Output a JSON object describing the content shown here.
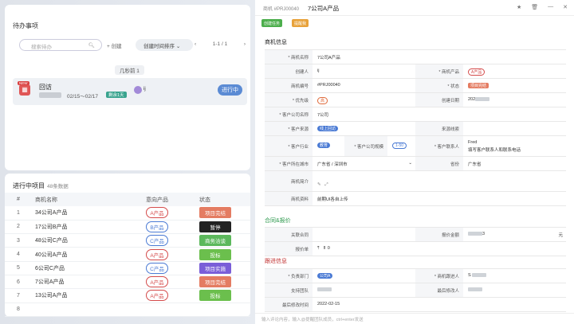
{
  "todo": {
    "title": "待办事项",
    "search_placeholder": "搜索待办",
    "create": "创建",
    "sort": "创建时间排序",
    "pager": "1-1 / 1",
    "time_group": "几秒前 1",
    "item": {
      "new": "NEW",
      "title": "回访",
      "dates": "02/15～02/17",
      "tag": "剩余1天",
      "user": "ij",
      "status": "进行中"
    }
  },
  "projects": {
    "title": "进行中项目",
    "count": "48条数据",
    "headers": [
      "#",
      "商机名称",
      "意向产品",
      "状态"
    ],
    "rows": [
      {
        "n": "1",
        "name": "34公司A产品",
        "product": "A产品",
        "status": "项目完结",
        "color": "#e47c62",
        "pcolor": "#d44a4a"
      },
      {
        "n": "2",
        "name": "17公司B产品",
        "product": "B产品",
        "status": "暂停",
        "color": "#222222",
        "pcolor": "#4a7ad4"
      },
      {
        "n": "3",
        "name": "48公司C产品",
        "product": "C产品",
        "status": "商务洽谈",
        "color": "#5cb85c",
        "pcolor": "#4a7ad4"
      },
      {
        "n": "4",
        "name": "40公司A产品",
        "product": "A产品",
        "status": "投标",
        "color": "#6bbf4d",
        "pcolor": "#d44a4a"
      },
      {
        "n": "5",
        "name": "6公司C产品",
        "product": "C产品",
        "status": "项目实施",
        "color": "#7a5ed8",
        "pcolor": "#4a7ad4"
      },
      {
        "n": "6",
        "name": "7公司A产品",
        "product": "A产品",
        "status": "项目完结",
        "color": "#e47c62",
        "pcolor": "#d44a4a"
      },
      {
        "n": "7",
        "name": "13公司A产品",
        "product": "A产品",
        "status": "投标",
        "color": "#6bbf4d",
        "pcolor": "#d44a4a"
      },
      {
        "n": "8",
        "name": "",
        "product": "",
        "status": "",
        "color": "#5cb85c",
        "pcolor": "#4a7ad4"
      }
    ]
  },
  "detail": {
    "prefix": "商机 #PRJ00040",
    "title": "7公司A产品",
    "btn1": "创建任务",
    "btn2": "提醒我",
    "sec_info": "商机信息",
    "sec_quote": "合同&报价",
    "sec_follow": "跟进信息",
    "f": {
      "name_l": "* 商机名称",
      "name_v": "7公司A产品",
      "creator_l": "创建人",
      "creator_v": "ij",
      "product_l": "* 商机产品",
      "product_v": "A产品",
      "no_l": "商机编号",
      "no_v": "#PRJ00040",
      "status_l": "* 状态",
      "status_v": "项目完结",
      "prio_l": "* 优先级",
      "prio_v": "高",
      "cdate_l": "创建日期",
      "cdate_v": "202",
      "cust_l": "* 客户公司名称",
      "cust_v": "7公司",
      "src_l": "* 客户来源",
      "src_v": "线上回访",
      "clue_l": "来源线索",
      "ind_l": "* 客户行业",
      "ind_v": "教育",
      "scale_l": "* 客户公司规模",
      "scale_v": "1-50",
      "contact_l": "* 客户联系人",
      "contact_v": "Fred",
      "contact_hint": "填写客户联系人和联系电话",
      "city_l": "* 客户所在城市",
      "city_v": "广东省 / 深圳市",
      "prov_l": "省份",
      "prov_v": "广东省",
      "desc_l": "商机简介",
      "data_l": "商机资料",
      "data_v": "前期UI各自上传",
      "contract_l": "关联合同",
      "quote_amt_l": "报价金额",
      "quote_amt_v": "3",
      "unit": "元",
      "quote_l": "报价单",
      "quote_v": "0",
      "dept_l": "* 负责部门",
      "dept_v": "公司A",
      "follower_l": "* 商机跟进人",
      "follower_v": "S",
      "team_l": "支持团队",
      "modifier_l": "最后修改人",
      "last_l": "最后修改时间",
      "last_v": "2022-02-15"
    },
    "bottom": "输入评论内容，输入@提醒团队成员，ctrl+enter发送"
  },
  "colors": {
    "accent": "#5b8bd4",
    "green": "#2f9a4f",
    "red": "#c03030"
  }
}
